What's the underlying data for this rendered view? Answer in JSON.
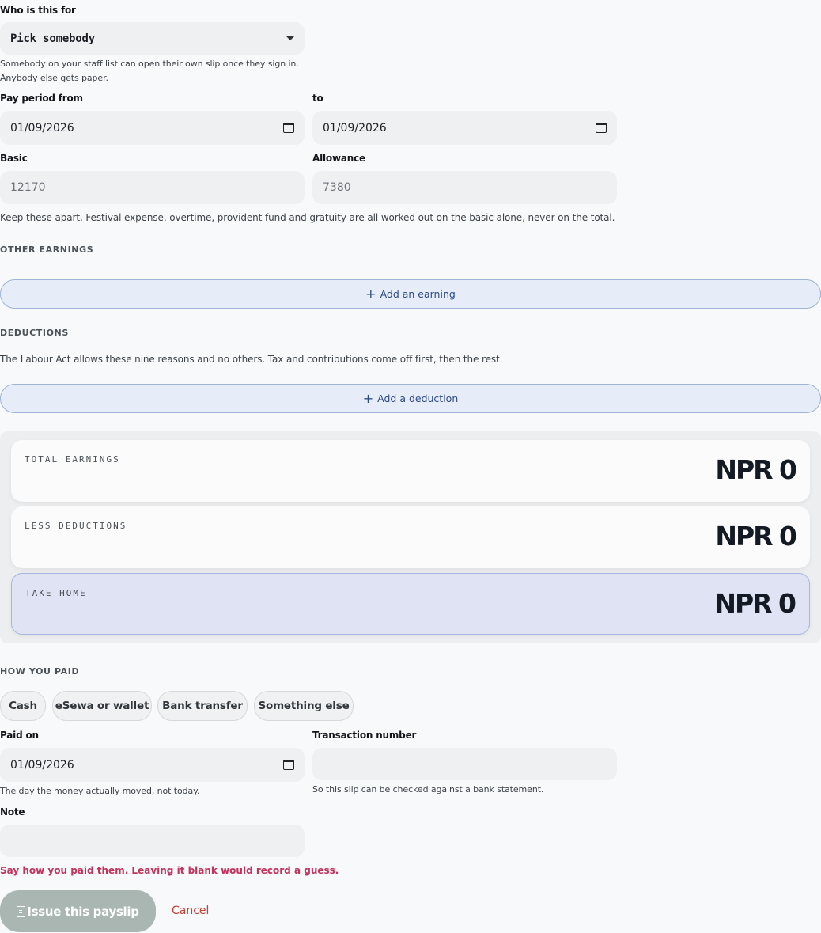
{
  "recipient": {
    "label": "Who is this for",
    "value": "Pick somebody",
    "help_line1": "Somebody on your staff list can open their own slip once they sign in.",
    "help_line2": "Anybody else gets paper."
  },
  "period": {
    "from_label": "Pay period from",
    "from_value": "01/09/2026",
    "to_label": "to",
    "to_value": "01/09/2026"
  },
  "pay": {
    "basic_label": "Basic",
    "basic_placeholder": "12170",
    "allowance_label": "Allowance",
    "allowance_placeholder": "7380",
    "help": "Keep these apart. Festival expense, overtime, provident fund and gratuity are all worked out on the basic alone, never on the total."
  },
  "earnings": {
    "heading": "OTHER EARNINGS",
    "add_label": "Add an earning",
    "add_icon": "+"
  },
  "deductions": {
    "heading": "DEDUCTIONS",
    "help": "The Labour Act allows these nine reasons and no others. Tax and contributions come off first, then the rest.",
    "add_label": "Add a deduction",
    "add_icon": "+"
  },
  "totals": {
    "earnings_label": "TOTAL EARNINGS",
    "earnings_value": "NPR 0",
    "deductions_label": "LESS DEDUCTIONS",
    "deductions_value": "NPR 0",
    "take_home_label": "TAKE HOME",
    "take_home_value": "NPR 0"
  },
  "payment": {
    "heading": "HOW YOU PAID",
    "methods": [
      "Cash",
      "eSewa or wallet",
      "Bank transfer",
      "Something else"
    ],
    "paid_on_label": "Paid on",
    "paid_on_value": "01/09/2026",
    "paid_on_help": "The day the money actually moved, not today.",
    "txn_label": "Transaction number",
    "txn_value": "",
    "txn_help": "So this slip can be checked against a bank statement.",
    "note_label": "Note",
    "note_value": "",
    "error": "Say how you paid them. Leaving it blank would record a guess."
  },
  "actions": {
    "issue_label": "Issue this payslip",
    "cancel_label": "Cancel"
  },
  "colors": {
    "accent": "#2d4a86",
    "error": "#c2325a",
    "cancel": "#c04236",
    "issue_disabled": "#a9b6b1"
  }
}
